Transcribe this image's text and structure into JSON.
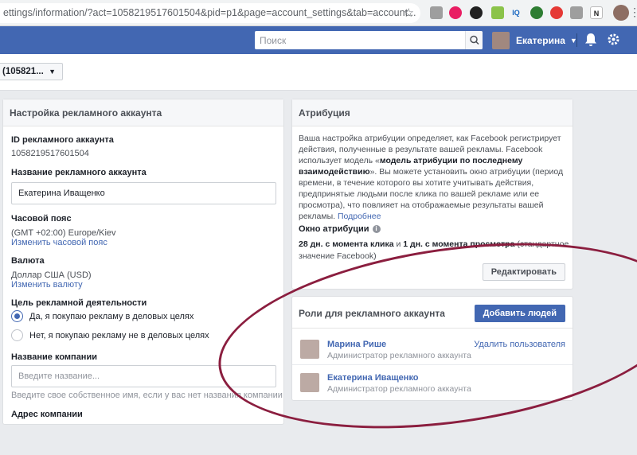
{
  "browser": {
    "url": "ettings/information/?act=1058219517601504&pid=p1&page=account_settings&tab=account...",
    "extensions": [
      "N"
    ]
  },
  "header": {
    "search_placeholder": "Поиск",
    "user_name": "Екатерина"
  },
  "account_selector": {
    "label": "(105821..."
  },
  "account_settings": {
    "title": "Настройка рекламного аккаунта",
    "id_label": "ID рекламного аккаунта",
    "id_value": "1058219517601504",
    "name_label": "Название рекламного аккаунта",
    "name_value": "Екатерина Иващенко",
    "timezone_label": "Часовой пояс",
    "timezone_value": "(GMT +02:00) Europe/Kiev",
    "timezone_link": "Изменить часовой пояс",
    "currency_label": "Валюта",
    "currency_value": "Доллар США (USD)",
    "currency_link": "Изменить валюту",
    "purpose_label": "Цель рекламной деятельности",
    "purpose_option_yes": "Да, я покупаю рекламу в деловых целях",
    "purpose_option_no": "Нет, я покупаю рекламу не в деловых целях",
    "company_label": "Название компании",
    "company_placeholder": "Введите название...",
    "company_hint": "Введите свое собственное имя, если у вас нет названия компании",
    "address_label": "Адрес компании"
  },
  "attribution": {
    "title": "Атрибуция",
    "desc_1": "Ваша настройка атрибуции определяет, как Facebook регистрирует действия, полученные в результате вашей рекламы. Facebook использует модель «",
    "desc_bold": "модель атрибуции по последнему взаимодействию",
    "desc_2": "». Вы можете установить окно атрибуции (период времени, в течение которого вы хотите учитывать действия, предпринятые людьми после клика по вашей рекламе или ее просмотра), что повлияет на отображаемые результаты вашей рекламы.",
    "more_link": "Подробнее",
    "window_label": "Окно атрибуции",
    "window_value_bold_1": "28 дн. с момента клика",
    "window_value_mid": " и ",
    "window_value_bold_2": "1 дн. с момента просмотра",
    "window_value_rest": " (стандартное значение Facebook)",
    "edit_button": "Редактировать"
  },
  "roles": {
    "title": "Роли для рекламного аккаунта",
    "add_button": "Добавить людей",
    "people": [
      {
        "name": "Марина Рише",
        "role": "Администратор рекламного аккаунта",
        "action": "Удалить пользователя"
      },
      {
        "name": "Екатерина Иващенко",
        "role": "Администратор рекламного аккаунта",
        "action": ""
      }
    ]
  },
  "colors": {
    "fb_blue": "#4267b2",
    "annotation": "#8b1e3f"
  }
}
